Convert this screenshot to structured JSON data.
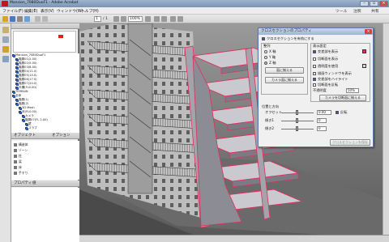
{
  "window": {
    "title": "Mansion_7080DuoF1 - Adobe Acrobat"
  },
  "menu": [
    "ファイル(F)",
    "編集(E)",
    "表示(V)",
    "ウィンドウ(W)",
    "ヘルプ(H)"
  ],
  "toolbar_right": [
    "ツール",
    "注釈",
    "共有"
  ],
  "toolbar": {
    "page": "1",
    "page_total": "/ 1",
    "zoom": "100%"
  },
  "panels": {
    "model_tree": "モデルツリー",
    "objects": "オブジェクト",
    "properties": "プロパティ",
    "property_col": "値",
    "options": "オプション"
  },
  "tree_items": [
    {
      "label": "Mansion_7080DuoF1",
      "checked": true
    },
    {
      "label": "階層01(2.00)",
      "checked": true
    },
    {
      "label": "階層02(5.00)",
      "checked": true
    },
    {
      "label": "階層03(8.00)",
      "checked": true
    },
    {
      "label": "階層04(11.0)",
      "checked": true
    },
    {
      "label": "階層05(14.0)",
      "checked": true
    },
    {
      "label": "階層06(17.0)",
      "checked": true
    },
    {
      "label": "階層07(20.0)",
      "checked": true
    },
    {
      "label": "外構(FL0.00)",
      "checked": true
    },
    {
      "label": "TERRAIN",
      "checked": true
    },
    {
      "label": "全体",
      "checked": true
    },
    {
      "label": "階層(1)",
      "checked": true
    },
    {
      "label": "階層(2)",
      "checked": true
    },
    {
      "label": "3D Mesh",
      "checked": true
    },
    {
      "label": "床(FL0.00)",
      "checked": true
    },
    {
      "label": "カメラ",
      "checked": true
    },
    {
      "label": "階層07(FL 2.00)",
      "checked": true
    },
    {
      "label": "壁",
      "checked": true
    },
    {
      "label": "スラブ",
      "checked": true
    }
  ],
  "object_items": [
    "構造体",
    "ゾーン",
    "柱",
    "梁",
    "床",
    "手すり"
  ],
  "dialog": {
    "title": "クロスセクションのプロパティ",
    "enable": "クロスセクションを有効にする",
    "align_title": "整列",
    "axes": [
      "X 軸",
      "Y 軸",
      "Z 軸"
    ],
    "align_btn": "面に揃える",
    "align_btn2": "カメラ面に揃える",
    "display_title": "表示設定",
    "display_options": [
      "交差部を表示",
      "切断面を表示",
      "透明度を使用",
      "描画ウィンドウを表示",
      "交差部をハイライト",
      "切断面を反転"
    ],
    "transparency_label": "不透明度",
    "transparency": "50%",
    "camera_btn": "カメラを切断面に揃える",
    "position_title": "位置と方向",
    "offset_label": "オフセット",
    "offset": "0.00",
    "tilt1_label": "傾き1",
    "tilt1": "0",
    "tilt2_label": "傾き2",
    "tilt2": "0",
    "flip_label": "反転",
    "bottom_btn": "クロスセクションを保存"
  },
  "colors": {
    "accent": "#2a5db0",
    "section": "#e0305a",
    "titlebar": "#8aa2c2"
  }
}
